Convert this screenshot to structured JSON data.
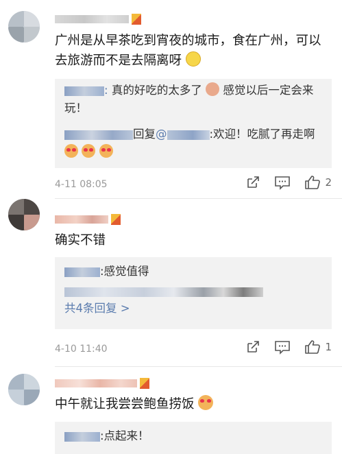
{
  "comments": [
    {
      "text": "广州是从早茶吃到宵夜的城市，食在广州，可以去旅游而不是去隔离呀",
      "replies": [
        {
          "text": "真的好吃的太多了",
          "text2": "感觉以后一定会来玩！"
        },
        {
          "action": "回复",
          "mention": "@",
          "text": ":欢迎！吃腻了再走啊"
        }
      ],
      "time": "4-11 08:05",
      "likes": "2"
    },
    {
      "text": "确实不错",
      "replies": [
        {
          "text": ":感觉值得"
        }
      ],
      "more_replies": "共4条回复 >",
      "time": "4-10 11:40",
      "likes": "1"
    },
    {
      "text": "中午就让我尝尝鲍鱼捞饭",
      "replies": [
        {
          "text": ":点起来！"
        }
      ]
    }
  ],
  "icons": {
    "share": "share-icon",
    "comment": "comment-icon",
    "like": "like-icon"
  },
  "colors": {
    "link": "#5b7cae",
    "reply_bg": "#f2f2f2",
    "meta": "#999999"
  }
}
